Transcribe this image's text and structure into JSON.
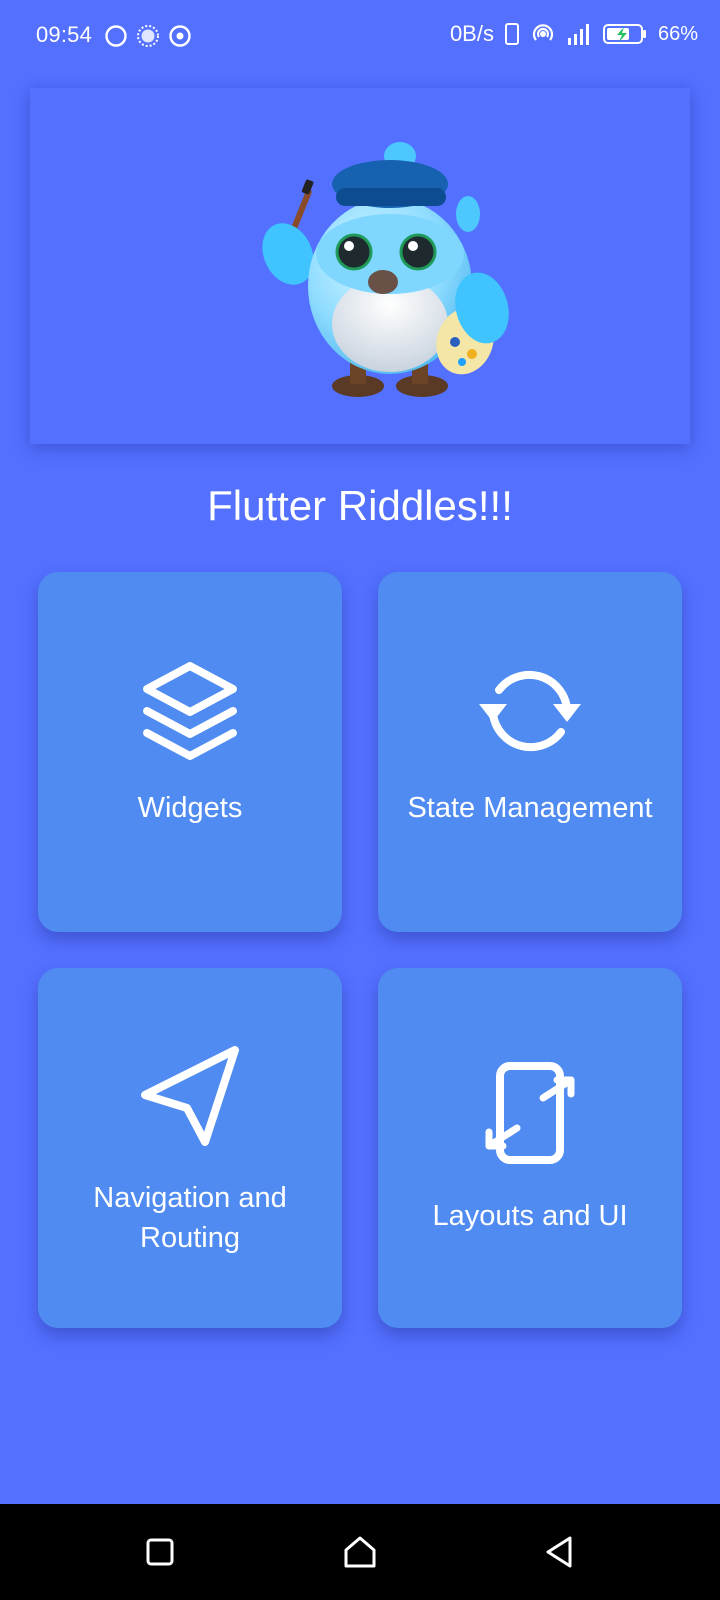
{
  "status_bar": {
    "time": "09:54",
    "net_speed": "0B/s",
    "battery_percent": "66%",
    "left_icons": [
      "circle-icon",
      "loading-icon",
      "target-icon"
    ],
    "right_icons": [
      "phone-icon",
      "hotspot-icon",
      "signal-icon",
      "battery-charging-icon"
    ]
  },
  "hero": {
    "image": "dash-mascot-painter"
  },
  "app": {
    "title": "Flutter Riddles!!!"
  },
  "categories": [
    {
      "label": "Widgets",
      "icon": "layers-icon"
    },
    {
      "label": "State Management",
      "icon": "refresh-icon"
    },
    {
      "label": "Navigation and Routing",
      "icon": "send-icon"
    },
    {
      "label": "Layouts and UI",
      "icon": "screen-rotation-icon"
    }
  ],
  "nav": {
    "buttons": [
      "recents-button",
      "home-button",
      "back-button"
    ]
  },
  "colors": {
    "background": "#5370ff",
    "card": "#4f8bf1",
    "text": "#ffffff",
    "nav_bar": "#000000"
  }
}
